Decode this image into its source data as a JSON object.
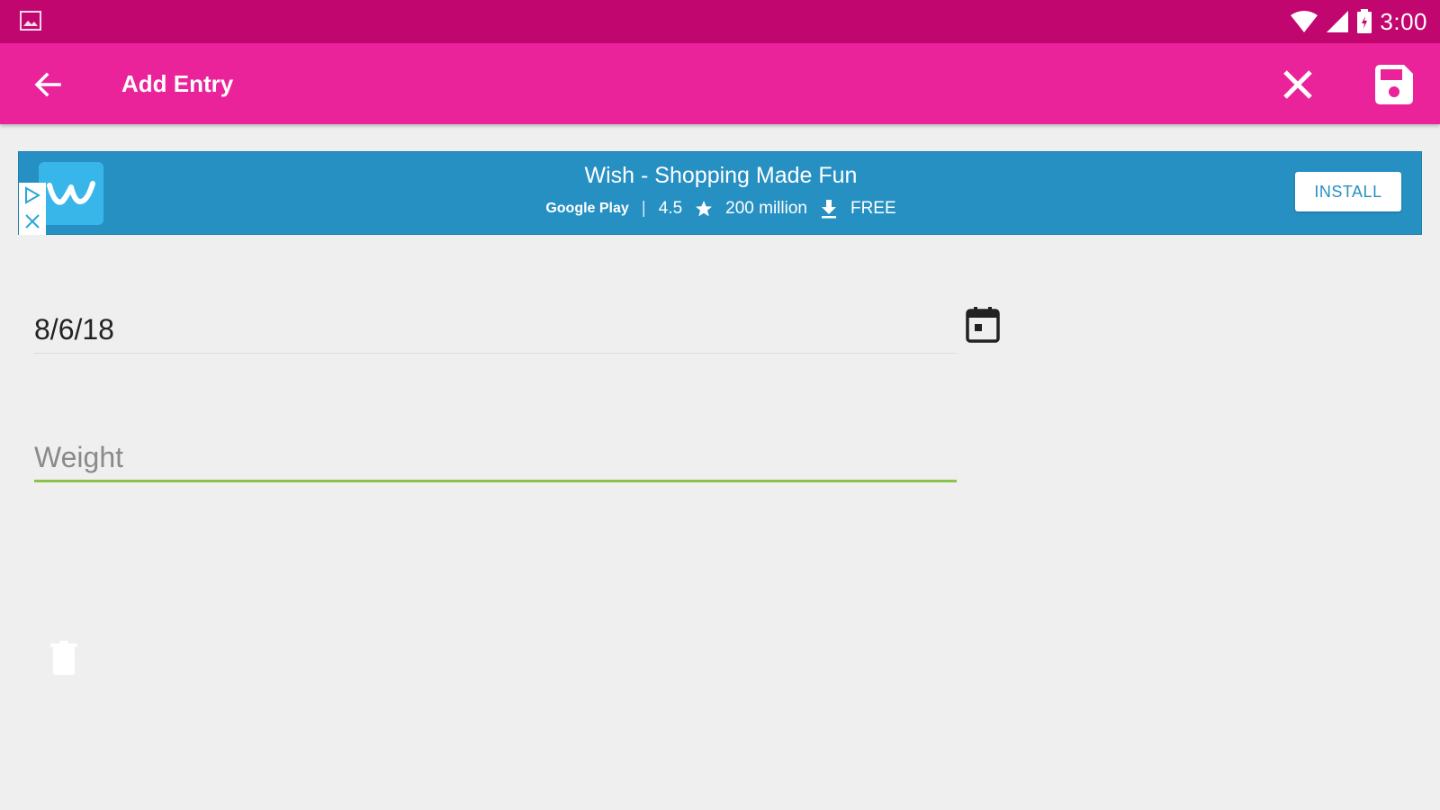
{
  "status_bar": {
    "time": "3:00",
    "icons": [
      "gallery-icon",
      "wifi-icon",
      "signal-icon",
      "battery-icon"
    ]
  },
  "app_bar": {
    "title": "Add Entry",
    "icons": [
      "arrow-back-icon",
      "close-icon",
      "save-icon"
    ],
    "color": "#ea239a",
    "status_color": "#c2066f"
  },
  "ad": {
    "headline": "Wish - Shopping Made Fun",
    "store": "Google Play",
    "rating": "4.5",
    "downloads": "200 million",
    "price": "FREE",
    "cta": "INSTALL",
    "logo_letter": "w",
    "color": "#2790c2"
  },
  "form": {
    "date_value": "8/6/18",
    "weight_placeholder": "Weight",
    "accent_color": "#8bc34a"
  }
}
